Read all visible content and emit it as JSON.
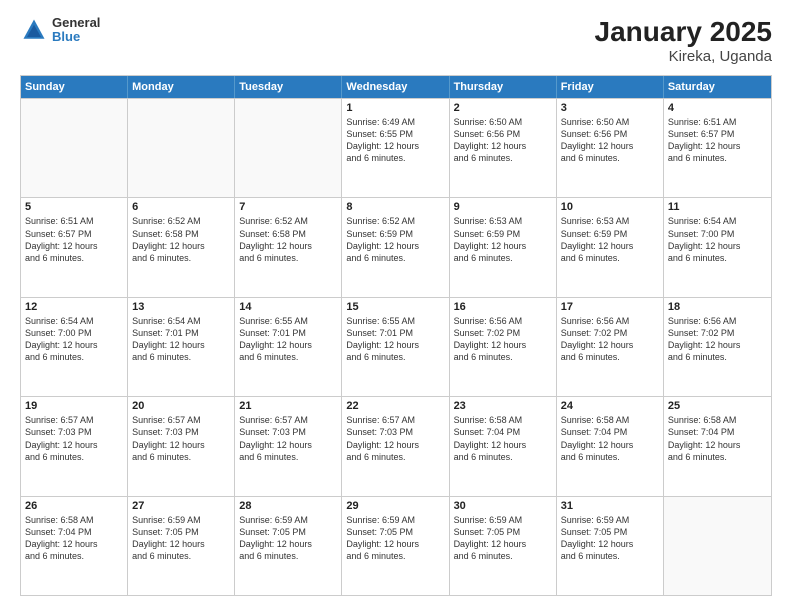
{
  "logo": {
    "line1": "General",
    "line2": "Blue"
  },
  "title": "January 2025",
  "subtitle": "Kireka, Uganda",
  "headers": [
    "Sunday",
    "Monday",
    "Tuesday",
    "Wednesday",
    "Thursday",
    "Friday",
    "Saturday"
  ],
  "weeks": [
    [
      {
        "day": "",
        "info": ""
      },
      {
        "day": "",
        "info": ""
      },
      {
        "day": "",
        "info": ""
      },
      {
        "day": "1",
        "info": "Sunrise: 6:49 AM\nSunset: 6:55 PM\nDaylight: 12 hours\nand 6 minutes."
      },
      {
        "day": "2",
        "info": "Sunrise: 6:50 AM\nSunset: 6:56 PM\nDaylight: 12 hours\nand 6 minutes."
      },
      {
        "day": "3",
        "info": "Sunrise: 6:50 AM\nSunset: 6:56 PM\nDaylight: 12 hours\nand 6 minutes."
      },
      {
        "day": "4",
        "info": "Sunrise: 6:51 AM\nSunset: 6:57 PM\nDaylight: 12 hours\nand 6 minutes."
      }
    ],
    [
      {
        "day": "5",
        "info": "Sunrise: 6:51 AM\nSunset: 6:57 PM\nDaylight: 12 hours\nand 6 minutes."
      },
      {
        "day": "6",
        "info": "Sunrise: 6:52 AM\nSunset: 6:58 PM\nDaylight: 12 hours\nand 6 minutes."
      },
      {
        "day": "7",
        "info": "Sunrise: 6:52 AM\nSunset: 6:58 PM\nDaylight: 12 hours\nand 6 minutes."
      },
      {
        "day": "8",
        "info": "Sunrise: 6:52 AM\nSunset: 6:59 PM\nDaylight: 12 hours\nand 6 minutes."
      },
      {
        "day": "9",
        "info": "Sunrise: 6:53 AM\nSunset: 6:59 PM\nDaylight: 12 hours\nand 6 minutes."
      },
      {
        "day": "10",
        "info": "Sunrise: 6:53 AM\nSunset: 6:59 PM\nDaylight: 12 hours\nand 6 minutes."
      },
      {
        "day": "11",
        "info": "Sunrise: 6:54 AM\nSunset: 7:00 PM\nDaylight: 12 hours\nand 6 minutes."
      }
    ],
    [
      {
        "day": "12",
        "info": "Sunrise: 6:54 AM\nSunset: 7:00 PM\nDaylight: 12 hours\nand 6 minutes."
      },
      {
        "day": "13",
        "info": "Sunrise: 6:54 AM\nSunset: 7:01 PM\nDaylight: 12 hours\nand 6 minutes."
      },
      {
        "day": "14",
        "info": "Sunrise: 6:55 AM\nSunset: 7:01 PM\nDaylight: 12 hours\nand 6 minutes."
      },
      {
        "day": "15",
        "info": "Sunrise: 6:55 AM\nSunset: 7:01 PM\nDaylight: 12 hours\nand 6 minutes."
      },
      {
        "day": "16",
        "info": "Sunrise: 6:56 AM\nSunset: 7:02 PM\nDaylight: 12 hours\nand 6 minutes."
      },
      {
        "day": "17",
        "info": "Sunrise: 6:56 AM\nSunset: 7:02 PM\nDaylight: 12 hours\nand 6 minutes."
      },
      {
        "day": "18",
        "info": "Sunrise: 6:56 AM\nSunset: 7:02 PM\nDaylight: 12 hours\nand 6 minutes."
      }
    ],
    [
      {
        "day": "19",
        "info": "Sunrise: 6:57 AM\nSunset: 7:03 PM\nDaylight: 12 hours\nand 6 minutes."
      },
      {
        "day": "20",
        "info": "Sunrise: 6:57 AM\nSunset: 7:03 PM\nDaylight: 12 hours\nand 6 minutes."
      },
      {
        "day": "21",
        "info": "Sunrise: 6:57 AM\nSunset: 7:03 PM\nDaylight: 12 hours\nand 6 minutes."
      },
      {
        "day": "22",
        "info": "Sunrise: 6:57 AM\nSunset: 7:03 PM\nDaylight: 12 hours\nand 6 minutes."
      },
      {
        "day": "23",
        "info": "Sunrise: 6:58 AM\nSunset: 7:04 PM\nDaylight: 12 hours\nand 6 minutes."
      },
      {
        "day": "24",
        "info": "Sunrise: 6:58 AM\nSunset: 7:04 PM\nDaylight: 12 hours\nand 6 minutes."
      },
      {
        "day": "25",
        "info": "Sunrise: 6:58 AM\nSunset: 7:04 PM\nDaylight: 12 hours\nand 6 minutes."
      }
    ],
    [
      {
        "day": "26",
        "info": "Sunrise: 6:58 AM\nSunset: 7:04 PM\nDaylight: 12 hours\nand 6 minutes."
      },
      {
        "day": "27",
        "info": "Sunrise: 6:59 AM\nSunset: 7:05 PM\nDaylight: 12 hours\nand 6 minutes."
      },
      {
        "day": "28",
        "info": "Sunrise: 6:59 AM\nSunset: 7:05 PM\nDaylight: 12 hours\nand 6 minutes."
      },
      {
        "day": "29",
        "info": "Sunrise: 6:59 AM\nSunset: 7:05 PM\nDaylight: 12 hours\nand 6 minutes."
      },
      {
        "day": "30",
        "info": "Sunrise: 6:59 AM\nSunset: 7:05 PM\nDaylight: 12 hours\nand 6 minutes."
      },
      {
        "day": "31",
        "info": "Sunrise: 6:59 AM\nSunset: 7:05 PM\nDaylight: 12 hours\nand 6 minutes."
      },
      {
        "day": "",
        "info": ""
      }
    ]
  ]
}
